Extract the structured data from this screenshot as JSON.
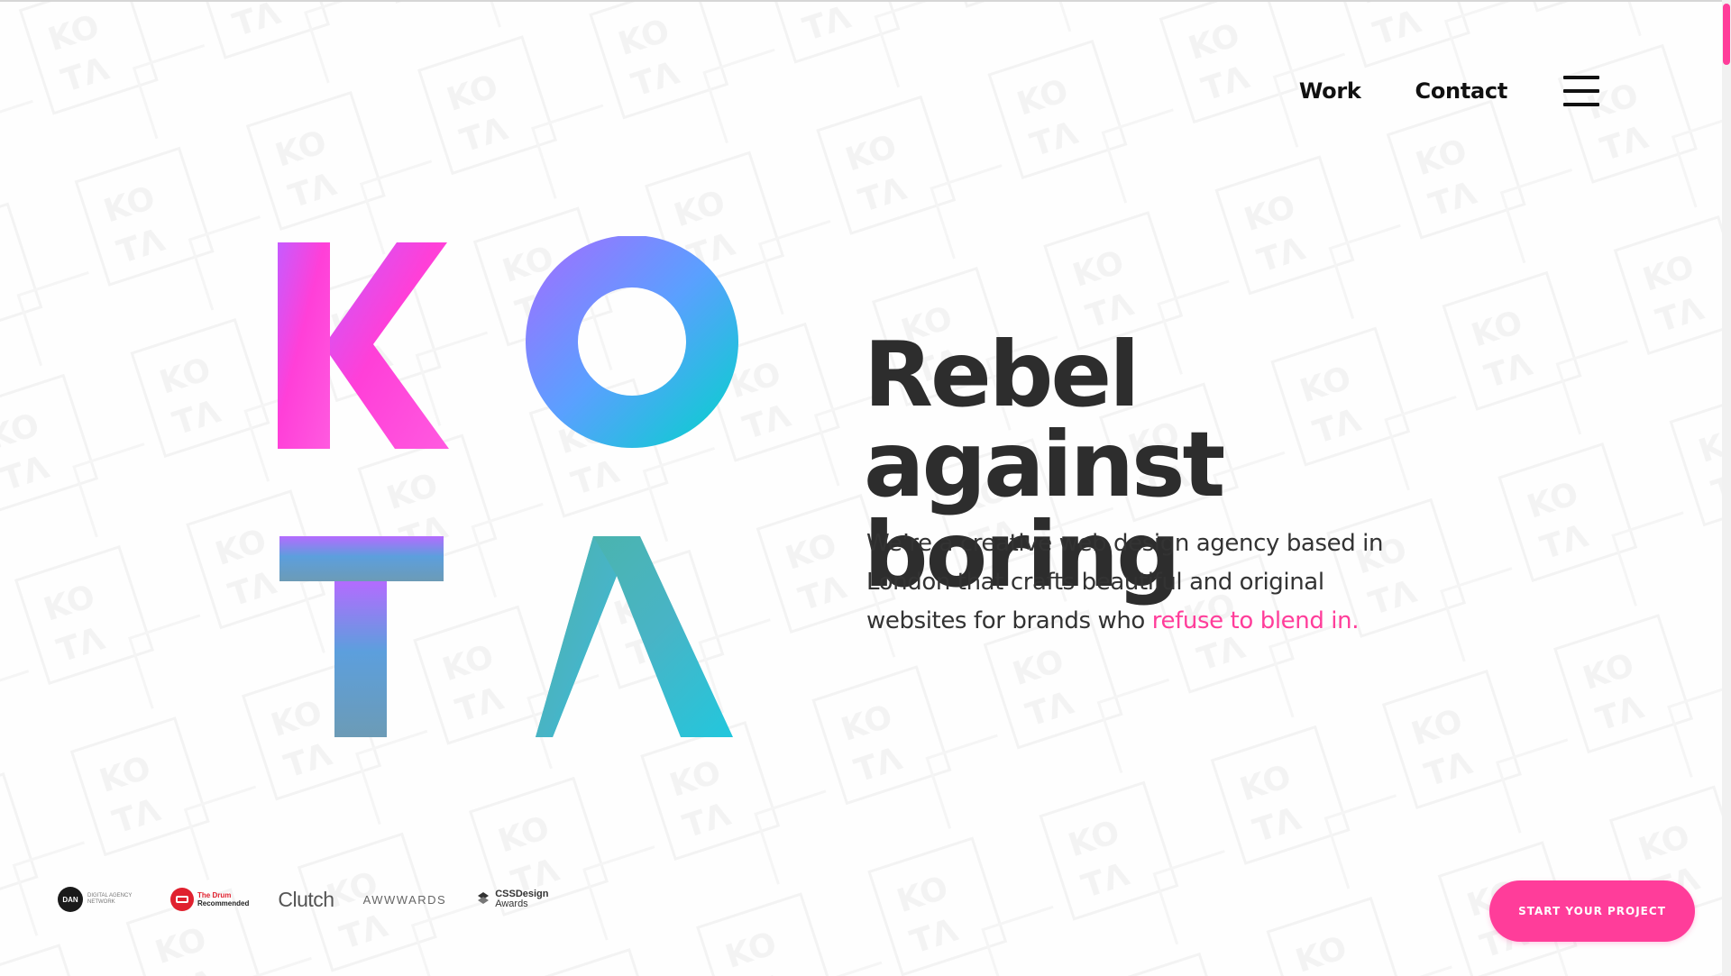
{
  "nav": {
    "work_label": "Work",
    "contact_label": "Contact",
    "menu_icon": "hamburger-menu-icon"
  },
  "logo": {
    "letters": [
      "K",
      "O",
      "T",
      "Λ"
    ],
    "background_watermark": [
      "KO",
      "TΛ"
    ]
  },
  "hero": {
    "title_line1": "Rebel against",
    "title_line2": "boring",
    "copy_main": "We’re a creative web design agency based in London that crafts beautiful and original websites for brands who ",
    "copy_accent": "refuse to blend in."
  },
  "awards": {
    "dan_badge": "DAN",
    "dan_text": "Digital Agency Network",
    "drum_title": "The Drum",
    "drum_sub": "Recommended",
    "clutch": "Clutch",
    "awwwards": "AWWWARDS",
    "css_line1": "CSSDesign",
    "css_line2": "Awards"
  },
  "cta": {
    "label": "Start your project"
  },
  "colors": {
    "accent": "#ff3d9a",
    "text_dark": "#2d2d2d",
    "gradient_pink": "#ff3fd8",
    "gradient_purple": "#a66bff",
    "gradient_blue": "#5aa0ff",
    "gradient_teal": "#00d4c9"
  }
}
